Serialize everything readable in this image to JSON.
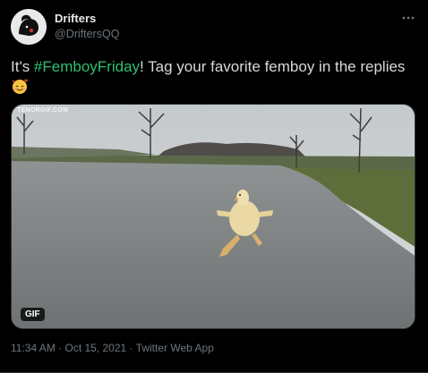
{
  "author": {
    "name": "Drifters",
    "handle": "@DriftersQQ"
  },
  "tweet": {
    "text_before": "It's ",
    "hashtag": "#FemboyFriday",
    "text_after": "! Tag your favorite femboy in the replies",
    "emoji": "smiling-face-with-hearts-icon"
  },
  "media": {
    "watermark": "TENORGIF.COM",
    "badge": "GIF"
  },
  "meta": {
    "time": "11:34 AM",
    "date": "Oct 15, 2021",
    "source": "Twitter Web App",
    "separator": " · "
  },
  "colors": {
    "background": "#000000",
    "text": "#d9d9d9",
    "secondary": "#6e767d",
    "hashtag": "#2fbf71"
  }
}
